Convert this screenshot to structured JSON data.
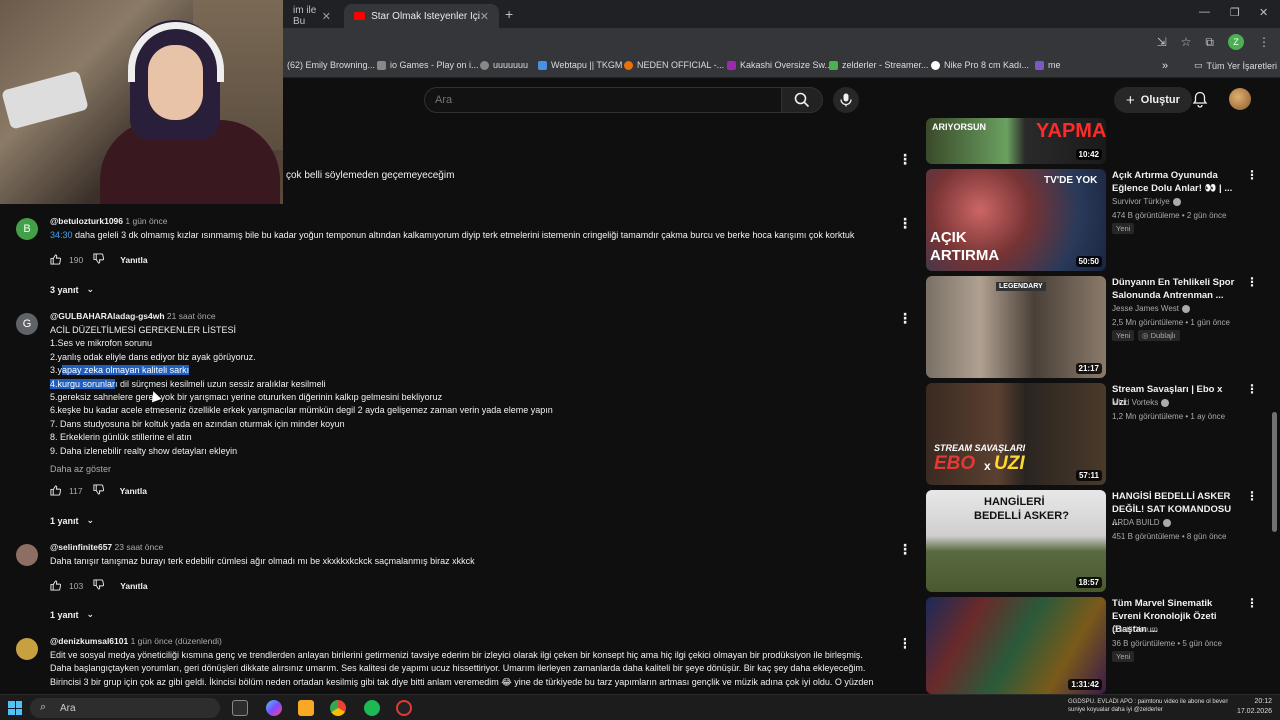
{
  "browser": {
    "tabs": [
      {
        "label": "im ile Bu",
        "active": false
      },
      {
        "label": "Star Olmak İsteyenler İçin İlk Gi",
        "active": true
      }
    ],
    "profile_letter": "Z",
    "bookmarks": [
      {
        "label": "(62) Emily Browning...",
        "color": "#ff0000"
      },
      {
        "label": "io Games - Play on i...",
        "color": "#888888"
      },
      {
        "label": "uuuuuuu",
        "color": "#888888"
      },
      {
        "label": "Webtapu || TKGM",
        "color": "#4a90e2"
      },
      {
        "label": "NEDEN OFFICIAL -...",
        "color": "#e8710a"
      },
      {
        "label": "Kakashi Oversize Sw...",
        "color": "#9c27b0"
      },
      {
        "label": "zelderler - Streamer...",
        "color": "#4caf50"
      },
      {
        "label": "Nike Pro 8 cm Kadı...",
        "color": "#ffffff"
      },
      {
        "label": "me",
        "color": "#7e57c2"
      }
    ],
    "all_bookmarks": "Tüm Yer İşaretleri"
  },
  "header": {
    "search_placeholder": "Ara",
    "create_label": "Oluştur"
  },
  "comments": {
    "top_fragment": "çok belli söylemeden geçemeyeceğim",
    "items": [
      {
        "avatar_letter": "B",
        "avatar_color": "#43a047",
        "handle": "@betulozturk1096",
        "time": "1 gün önce",
        "timestamp": "34:30",
        "text": " daha geleli 3 dk olmamış kızlar ısınmamış bile bu kadar yoğun temponun altından kalkamıyorum diyip terk etmelerini istemenin cringeliği tamamdır çakma burcu ve berke hoca karışımı çok korktuk",
        "likes": "190",
        "reply": "Yanıtla",
        "replies": "3 yanıt"
      },
      {
        "avatar_letter": "G",
        "avatar_color": "#5f6368",
        "handle": "@GULBAHARAladag-gs4wh",
        "time": "21 saat önce",
        "lines": [
          "ACİL DÜZELTİLMESİ GEREKENLER LİSTESİ",
          "1.Ses ve mikrofon sorunu",
          "2.yanlış odak eliyle dans ediyor biz ayak görüyoruz.",
          "3.yapay zeka olmayan kaliteli sarkı",
          "4.kurgu sorunları dil sürçmesi kesilmeli uzun sessiz aralıklar kesilmeli",
          "5.gereksiz sahnelere gerek yok bir yarışmacı yerine otururken diğerinin kalkıp gelmesini bekliyoruz",
          "6.keşke bu kadar acele etmeseniz özellikle erkek yarışmacılar mümkün degil 2 ayda gelişemez zaman verin yada eleme yapın",
          "7. Dans studyosuna bir koltuk yada en azından oturmak için minder koyun",
          "8. Erkeklerin günlük stillerine el atın",
          "9. Daha izlenebilir realty show detayları ekleyin"
        ],
        "show_less": "Daha az göster",
        "likes": "117",
        "reply": "Yanıtla",
        "replies": "1 yanıt"
      },
      {
        "avatar_color": "#8d6e63",
        "handle": "@selinfinite657",
        "time": "23 saat önce",
        "text": "Daha tanışır tanışmaz burayı terk edebilir cümlesi ağır olmadı mı be xkxkkxkckck saçmalanmış biraz xkkck",
        "likes": "103",
        "reply": "Yanıtla",
        "replies": "1 yanıt"
      },
      {
        "avatar_color": "#c8a040",
        "handle": "@denizkumsal6101",
        "time": "1 gün önce (düzenlendi)",
        "lines": [
          "Edit ve sosyal medya yöneticiliği kısmına genç ve trendlerden anlayan birilerini getirmenizi tavsiye ederim bir izleyici olarak ilgi çeken bir konsept hiç ama hiç ilgi çekici olmayan bir prodüksiyon ile birleşmiş.",
          "Daha başlangıçtayken yorumları, geri dönüşleri dikkate alırsınız umarım. Ses kalitesi de yapımı ucuz hissettiriyor. Umarım ilerleyen zamanlarda daha kaliteli bir şeye dönüşür. Bir kaç şey daha ekleyeceğim.",
          "Birincisi 3 bir grup için çok az gibi geldi. İkincisi bölüm neden ortadan kesilmiş gibi tak diye bitti anlam veremedim 😂 yine de türkiyede bu tarz yapımların artması gençlik ve müzik adına çok iyi oldu. O yüzden"
        ]
      }
    ]
  },
  "sidebar": {
    "videos": [
      {
        "title": "",
        "channel": "",
        "meta": "",
        "duration": "10:42",
        "thumb_texts": [
          "ARIYORSUN",
          "YAPMA"
        ]
      },
      {
        "title": "Açık Artırma Oyununda Eğlence Dolu Anlar! 👀 | ...",
        "channel": "Survivor Türkiye",
        "meta": "474 B görüntüleme • 2 gün önce",
        "badge": "Yeni",
        "duration": "50:50",
        "thumb_texts": [
          "AÇIK",
          "ARTIRMA",
          "TV'DE YOK"
        ]
      },
      {
        "title": "Dünyanın En Tehlikeli Spor Salonunda Antrenman ...",
        "channel": "Jesse James West",
        "meta": "2,5 Mn görüntüleme • 1 gün önce",
        "badge": "Yeni",
        "badge2": "Dublajlı",
        "duration": "21:17",
        "thumb_texts": [
          "LEGENDARY"
        ]
      },
      {
        "title": "Stream Savaşları | Ebo x Uzi",
        "channel": "Mind Vorteks",
        "meta": "1,2 Mn görüntüleme • 1 ay önce",
        "duration": "57:11",
        "thumb_texts": [
          "STREAM SAVAŞLARI",
          "EBO",
          "x",
          "UZI"
        ]
      },
      {
        "title": "HANGİSİ BEDELLİ ASKER DEĞİL! SAT KOMANDOSU ...",
        "channel": "ARDA BUILD",
        "meta": "451 B görüntüleme • 8 gün önce",
        "duration": "18:57",
        "thumb_texts": [
          "HANGİLERİ",
          "BEDELLİ ASKER?"
        ]
      },
      {
        "title": "Tüm Marvel Sinematik Evreni Kronolojik Özeti (Baştan ...",
        "channel": "Özetli-Yorum",
        "meta": "36 B görüntüleme • 5 gün önce",
        "badge": "Yeni",
        "duration": "1:31:42",
        "thumb_texts": []
      }
    ]
  },
  "taskbar": {
    "search_placeholder": "Ara",
    "notification_line1": "GGDSPU. EVLADI APO : paimtonu video ile abone ol beven yazıp söleyebirsa 5",
    "notification_line2": "suniye koyualar daha iyi @zelderler",
    "time": "20:12",
    "date": "17.02.2026"
  }
}
